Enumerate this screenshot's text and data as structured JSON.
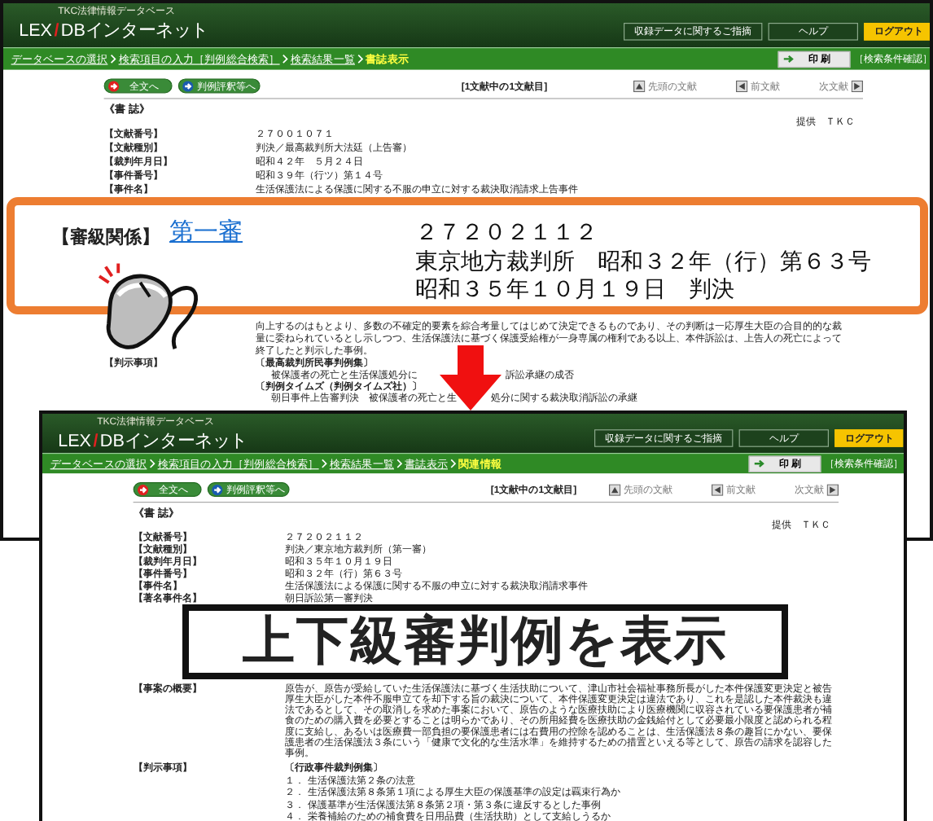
{
  "screens": [
    {
      "header": {
        "tagline": "TKC法律情報データベース",
        "logo": {
          "prefix": "LEX",
          "mark": "/",
          "suffix": "DBインターネット"
        },
        "buttons": [
          {
            "label": "収録データに関するご指摘",
            "kind": "plain"
          },
          {
            "label": "ヘルプ",
            "kind": "plain"
          },
          {
            "label": "ログアウト",
            "kind": "logout"
          }
        ]
      },
      "nav": [
        {
          "label": "データベースの選択",
          "selected": false
        },
        {
          "label": "検索項目の入力［判例総合検索］",
          "selected": false
        },
        {
          "label": "検索結果一覧",
          "selected": false
        },
        {
          "label": "書誌表示",
          "selected": true
        }
      ],
      "print": "印 刷",
      "search_conditions": "［検索条件確認］",
      "toolbar": {
        "buttons": [
          {
            "label": "全文へ",
            "color": "#e02020"
          },
          {
            "label": "判例評釈等へ",
            "color": "#1a5bb0"
          }
        ],
        "counter": "[1文献中の1文献目]",
        "links": [
          {
            "label": "先頭の文献",
            "kind": "first"
          },
          {
            "label": "前文献",
            "kind": "prev"
          },
          {
            "label": "次文献",
            "kind": "next"
          }
        ]
      },
      "section_title": "《書 誌》",
      "provider": "提供　ＴＫＣ",
      "fields": [
        {
          "label": "【文献番号】",
          "value": "２７００１０７１"
        },
        {
          "label": "【文献種別】",
          "value": "判決／最高裁判所大法廷（上告審）"
        },
        {
          "label": "【裁判年月日】",
          "value": "昭和４２年　５月２４日"
        },
        {
          "label": "【事件番号】",
          "value": "昭和３９年（行ツ）第１４号"
        },
        {
          "label": "【事件名】",
          "value": "生活保護法による保護に関する不服の申立に対する裁決取消請求上告事件"
        }
      ],
      "lower": [
        {
          "kind": "paragraph",
          "text": "向上するのはもとより、多数の不確定的要素を綜合考量してはじめて決定できるものであり、その判断は一応厚生大臣の合目的的な裁量に委ねられているとし示しつつ、生活保護法に基づく保護受給権が一身専属の権利である以上、本件訴訟は、上告人の死亡によって終了したと判示した事例。"
        },
        {
          "kind": "block",
          "label": "【判示事項】",
          "lines": [
            {
              "kind": "heading",
              "text": "〔最高裁判所民事判例集〕"
            },
            {
              "kind": "line",
              "text": "被保護者の死亡と生活保護処分に",
              "continuation": "訴訟承継の成否"
            },
            {
              "kind": "heading",
              "text": "〔判例タイムズ（判例タイムズ社）〕"
            },
            {
              "kind": "line",
              "text": "朝日事件上告審判決　被保護者の死亡と生",
              "continuation": "処分に関する裁決取消訴訟の承継"
            }
          ]
        }
      ]
    },
    {
      "header": {
        "tagline": "TKC法律情報データベース",
        "logo": {
          "prefix": "LEX",
          "mark": "/",
          "suffix": "DBインターネット"
        },
        "buttons": [
          {
            "label": "収録データに関するご指摘",
            "kind": "plain"
          },
          {
            "label": "ヘルプ",
            "kind": "plain"
          },
          {
            "label": "ログアウト",
            "kind": "logout"
          }
        ]
      },
      "nav": [
        {
          "label": "データベースの選択",
          "selected": false
        },
        {
          "label": "検索項目の入力［判例総合検索］",
          "selected": false
        },
        {
          "label": "検索結果一覧",
          "selected": false
        },
        {
          "label": "書誌表示",
          "selected": false
        },
        {
          "label": "関連情報",
          "selected": true
        }
      ],
      "print": "印 刷",
      "search_conditions": "［検索条件確認］",
      "toolbar": {
        "buttons": [
          {
            "label": "全文へ",
            "color": "#e02020"
          },
          {
            "label": "判例評釈等へ",
            "color": "#1a5bb0"
          }
        ],
        "counter": "[1文献中の1文献目]",
        "links": [
          {
            "label": "先頭の文献",
            "kind": "first"
          },
          {
            "label": "前文献",
            "kind": "prev"
          },
          {
            "label": "次文献",
            "kind": "next"
          }
        ]
      },
      "section_title": "《書 誌》",
      "provider": "提供　ＴＫＣ",
      "fields": [
        {
          "label": "【文献番号】",
          "value": "２７２０２１１２"
        },
        {
          "label": "【文献種別】",
          "value": "判決／東京地方裁判所（第一審）"
        },
        {
          "label": "【裁判年月日】",
          "value": "昭和３５年１０月１９日"
        },
        {
          "label": "【事件番号】",
          "value": "昭和３２年（行）第６３号"
        },
        {
          "label": "【事件名】",
          "value": "生活保護法による保護に関する不服の申立に対する裁決取消請求事件"
        },
        {
          "label": "【著名事件名】",
          "value": "朝日訴訟第一審判決"
        }
      ],
      "lower": [
        {
          "kind": "paragraph",
          "label": "【事案の概要】",
          "text": "原告が、原告が受給していた生活保護法に基づく生活扶助について、津山市社会福祉事務所長がした本件保護変更決定と被告厚生大臣がした本件不服申立てを却下する旨の裁決について、本件保護変更決定は違法であり、これを是認した本件裁決も違法であるとして、その取消しを求めた事案において、原告のような医療扶助により医療機関に収容されている要保護患者が補食のための購入費を必要とすることは明らかであり、その所用経費を医療扶助の金銭給付として必要最小限度と認められる程度に支給し、あるいは医療費一部負担の要保護患者には右費用の控除を認めることは、生活保護法８条の趣旨にかない、要保護患者の生活保護法３条にいう「健康で文化的な生活水準」を維持するための措置といえる等として、原告の請求を認容した事例。"
        },
        {
          "kind": "block",
          "label": "【判示事項】",
          "lines": [
            {
              "kind": "heading",
              "text": "〔行政事件裁判例集〕"
            },
            {
              "kind": "item",
              "number": "１．",
              "text": "生活保護法第２条の法意"
            },
            {
              "kind": "item",
              "number": "２．",
              "text": "生活保護法第８条第１項による厚生大臣の保護基準の設定は覊束行為か"
            },
            {
              "kind": "item",
              "number": "３．",
              "text": "保護基準が生活保護法第８条第２項・第３条に違反するとした事例"
            },
            {
              "kind": "item",
              "number": "４．",
              "text": "栄養補給のための補食費を日用品費（生活扶助）として支給しうるか"
            }
          ]
        }
      ]
    }
  ],
  "callout": {
    "label": "【審級関係】",
    "link": "第一審",
    "lines": [
      "２７２０２１１２",
      "東京地方裁判所　昭和３２年（行）第６３号",
      "昭和３５年１０月１９日　判決"
    ]
  },
  "caption": "上下級審判例を表示"
}
